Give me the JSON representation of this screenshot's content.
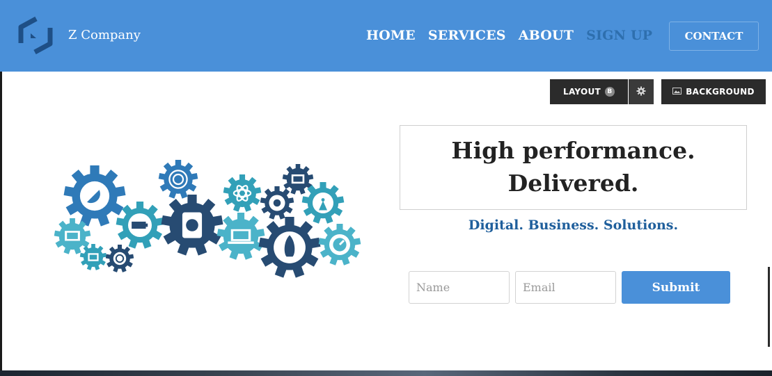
{
  "header": {
    "brand": "Z Company",
    "nav": [
      {
        "label": "HOME",
        "active": false
      },
      {
        "label": "SERVICES",
        "active": false
      },
      {
        "label": "ABOUT",
        "active": false
      },
      {
        "label": "SIGN UP",
        "active": true
      }
    ],
    "contact_label": "CONTACT"
  },
  "toolbar": {
    "layout_label": "LAYOUT",
    "layout_badge": "B",
    "background_label": "BACKGROUND"
  },
  "hero": {
    "headline_line1": "High performance.",
    "headline_line2": "Delivered.",
    "tagline": "Digital. Business. Solutions."
  },
  "form": {
    "name_placeholder": "Name",
    "email_placeholder": "Email",
    "submit_label": "Submit"
  },
  "colors": {
    "header_bg": "#4a90d9",
    "active_nav": "#2e6fae",
    "tagline": "#1f5f9c",
    "toolbar_bg": "#2b2b2b",
    "gear_dark": "#274b72",
    "gear_mid": "#2f7ab8",
    "gear_teal": "#32a0b8",
    "gear_light": "#4bb3c9"
  },
  "icons": [
    "logo-icon",
    "gear-icon",
    "image-icon",
    "satellite-icon",
    "battery-icon",
    "hard-drive-icon",
    "laptop-icon",
    "rocket-icon",
    "atom-icon",
    "webcam-icon",
    "antenna-icon",
    "terminal-icon",
    "monitor-icon",
    "gauge-icon",
    "fingerprint-icon",
    "target-icon"
  ]
}
